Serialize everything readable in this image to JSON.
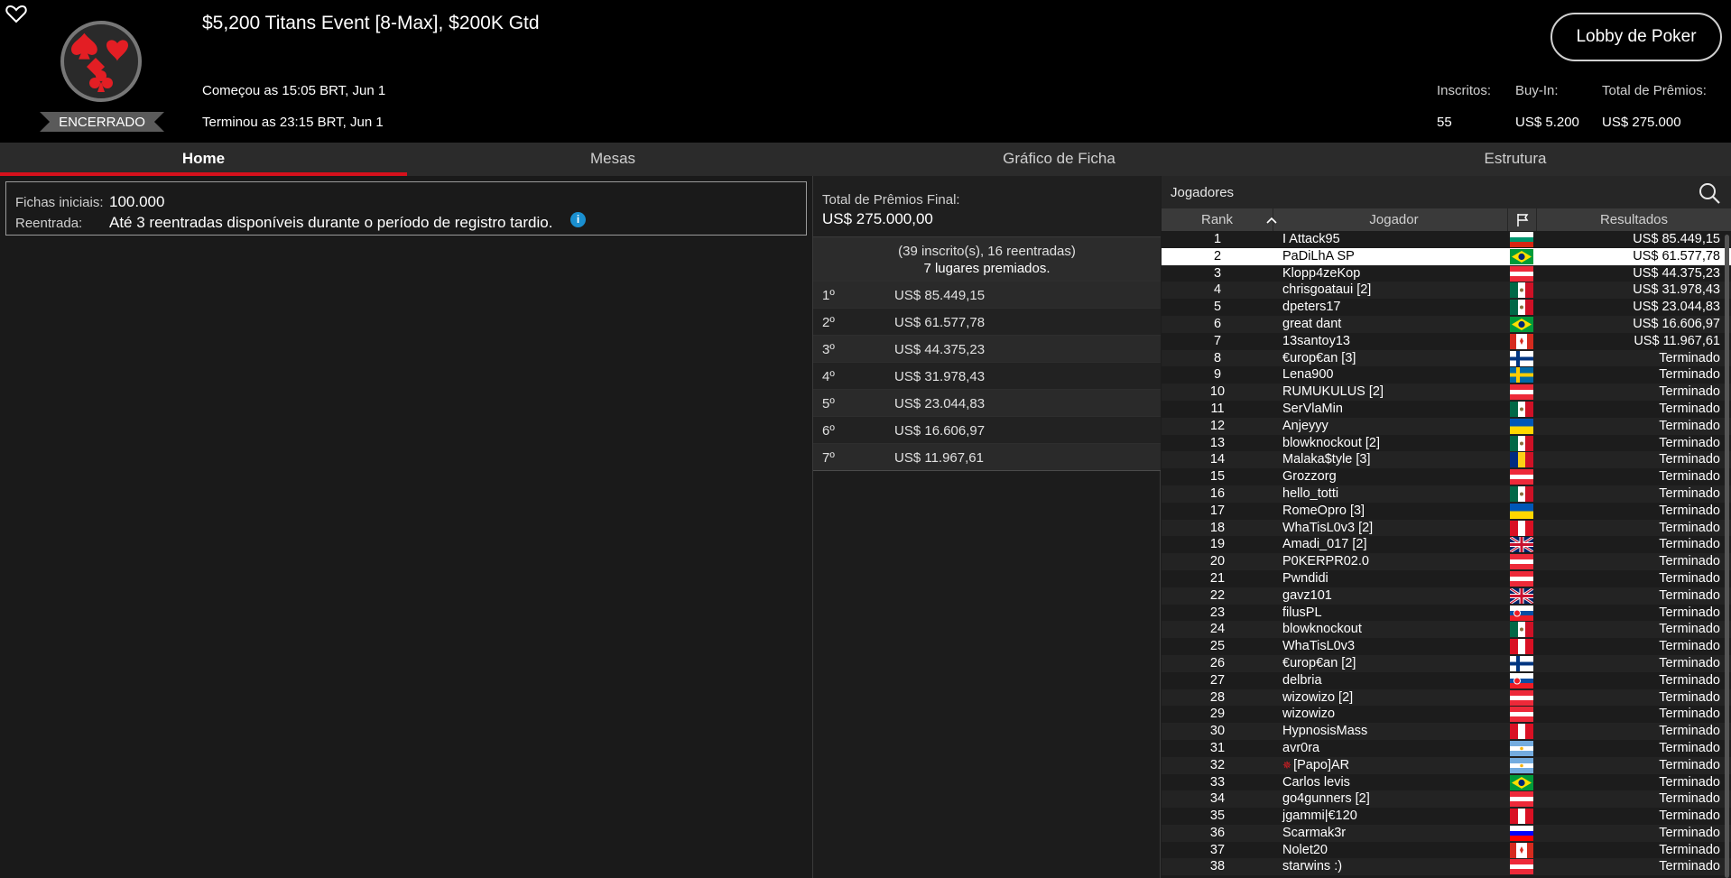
{
  "header": {
    "title": "$5,200 Titans Event [8-Max], $200K Gtd",
    "status": "ENCERRADO",
    "started": "Começou as 15:05 BRT, Jun 1",
    "ended": "Terminou as 23:15 BRT, Jun 1",
    "lobby_button": "Lobby de Poker",
    "stats": {
      "registered_label": "Inscritos:",
      "registered_value": "55",
      "buyin_label": "Buy-In:",
      "buyin_value": "US$ 5.200",
      "prizepool_label": "Total de Prêmios:",
      "prizepool_value": "US$ 275.000"
    }
  },
  "tabs": [
    "Home",
    "Mesas",
    "Gráfico de Ficha",
    "Estrutura"
  ],
  "info": {
    "chips_label": "Fichas iniciais:",
    "chips_value": "100.000",
    "reentry_label": "Reentrada:",
    "reentry_value": "Até 3 reentradas disponíveis durante o período de registro tardio."
  },
  "prizes": {
    "final_label": "Total de Prêmios Final:",
    "final_value": "US$ 275.000,00",
    "summary_line1": "(39 inscrito(s), 16 reentradas)",
    "summary_line2": "7 lugares premiados.",
    "list": [
      {
        "pos": "1º",
        "amount": "US$ 85.449,15"
      },
      {
        "pos": "2º",
        "amount": "US$ 61.577,78"
      },
      {
        "pos": "3º",
        "amount": "US$ 44.375,23"
      },
      {
        "pos": "4º",
        "amount": "US$ 31.978,43"
      },
      {
        "pos": "5º",
        "amount": "US$ 23.044,83"
      },
      {
        "pos": "6º",
        "amount": "US$ 16.606,97"
      },
      {
        "pos": "7º",
        "amount": "US$ 11.967,61"
      }
    ]
  },
  "players": {
    "title": "Jogadores",
    "columns": {
      "rank": "Rank",
      "player": "Jogador",
      "results": "Resultados"
    },
    "selected_rank": 2,
    "rows": [
      {
        "rank": "1",
        "name": "I Attack95",
        "flag": "bg",
        "result": "US$ 85.449,15"
      },
      {
        "rank": "2",
        "name": "PaDiLhA SP",
        "flag": "br",
        "result": "US$ 61.577,78"
      },
      {
        "rank": "3",
        "name": "Klopp4zeKop",
        "flag": "at",
        "result": "US$ 44.375,23"
      },
      {
        "rank": "4",
        "name": "chrisgoataui [2]",
        "flag": "mx",
        "result": "US$ 31.978,43"
      },
      {
        "rank": "5",
        "name": "dpeters17",
        "flag": "mx",
        "result": "US$ 23.044,83"
      },
      {
        "rank": "6",
        "name": "great dant",
        "flag": "br",
        "result": "US$ 16.606,97"
      },
      {
        "rank": "7",
        "name": "13santoy13",
        "flag": "ca",
        "result": "US$ 11.967,61"
      },
      {
        "rank": "8",
        "name": "€urop€an [3]",
        "flag": "fi",
        "result": "Terminado"
      },
      {
        "rank": "9",
        "name": "Lena900",
        "flag": "se",
        "result": "Terminado"
      },
      {
        "rank": "10",
        "name": "RUMUKULUS [2]",
        "flag": "at",
        "result": "Terminado"
      },
      {
        "rank": "11",
        "name": "SerVlaMin",
        "flag": "mx",
        "result": "Terminado"
      },
      {
        "rank": "12",
        "name": "Anjeyyy",
        "flag": "ua",
        "result": "Terminado"
      },
      {
        "rank": "13",
        "name": "blowknockout [2]",
        "flag": "mx",
        "result": "Terminado"
      },
      {
        "rank": "14",
        "name": "Malaka$tyle [3]",
        "flag": "ro",
        "result": "Terminado"
      },
      {
        "rank": "15",
        "name": "Grozzorg",
        "flag": "at",
        "result": "Terminado"
      },
      {
        "rank": "16",
        "name": "hello_totti",
        "flag": "mx",
        "result": "Terminado"
      },
      {
        "rank": "17",
        "name": "RomeOpro [3]",
        "flag": "ua",
        "result": "Terminado"
      },
      {
        "rank": "18",
        "name": "WhaTisL0v3 [2]",
        "flag": "pe",
        "result": "Terminado"
      },
      {
        "rank": "19",
        "name": "Amadi_017 [2]",
        "flag": "gb",
        "result": "Terminado"
      },
      {
        "rank": "20",
        "name": "P0KERPR02.0",
        "flag": "at",
        "result": "Terminado"
      },
      {
        "rank": "21",
        "name": "Pwndidi",
        "flag": "at",
        "result": "Terminado"
      },
      {
        "rank": "22",
        "name": "gavz101",
        "flag": "gb",
        "result": "Terminado"
      },
      {
        "rank": "23",
        "name": "filusPL",
        "flag": "sk",
        "result": "Terminado"
      },
      {
        "rank": "24",
        "name": "blowknockout",
        "flag": "mx",
        "result": "Terminado"
      },
      {
        "rank": "25",
        "name": "WhaTisL0v3",
        "flag": "pe",
        "result": "Terminado"
      },
      {
        "rank": "26",
        "name": "€urop€an [2]",
        "flag": "fi",
        "result": "Terminado"
      },
      {
        "rank": "27",
        "name": "delbria",
        "flag": "sk",
        "result": "Terminado"
      },
      {
        "rank": "28",
        "name": "wizowizo [2]",
        "flag": "at",
        "result": "Terminado"
      },
      {
        "rank": "29",
        "name": "wizowizo",
        "flag": "at",
        "result": "Terminado"
      },
      {
        "rank": "30",
        "name": "HypnosisMass",
        "flag": "pe",
        "result": "Terminado"
      },
      {
        "rank": "31",
        "name": "avr0ra",
        "flag": "ar",
        "result": "Terminado"
      },
      {
        "rank": "32",
        "name": "[Papo]AR",
        "flag": "ar",
        "result": "Terminado",
        "star": true
      },
      {
        "rank": "33",
        "name": "Carlos levis",
        "flag": "br",
        "result": "Terminado"
      },
      {
        "rank": "34",
        "name": "go4gunners [2]",
        "flag": "at",
        "result": "Terminado"
      },
      {
        "rank": "35",
        "name": "jgammi|€120",
        "flag": "pe",
        "result": "Terminado"
      },
      {
        "rank": "36",
        "name": "Scarmak3r",
        "flag": "si",
        "result": "Terminado"
      },
      {
        "rank": "37",
        "name": "Nolet20",
        "flag": "ca",
        "result": "Terminado"
      },
      {
        "rank": "38",
        "name": "starwins :)",
        "flag": "at",
        "result": "Terminado"
      }
    ]
  },
  "colors": {
    "accent": "#d6111c",
    "info_icon": "#1a8fd0"
  }
}
